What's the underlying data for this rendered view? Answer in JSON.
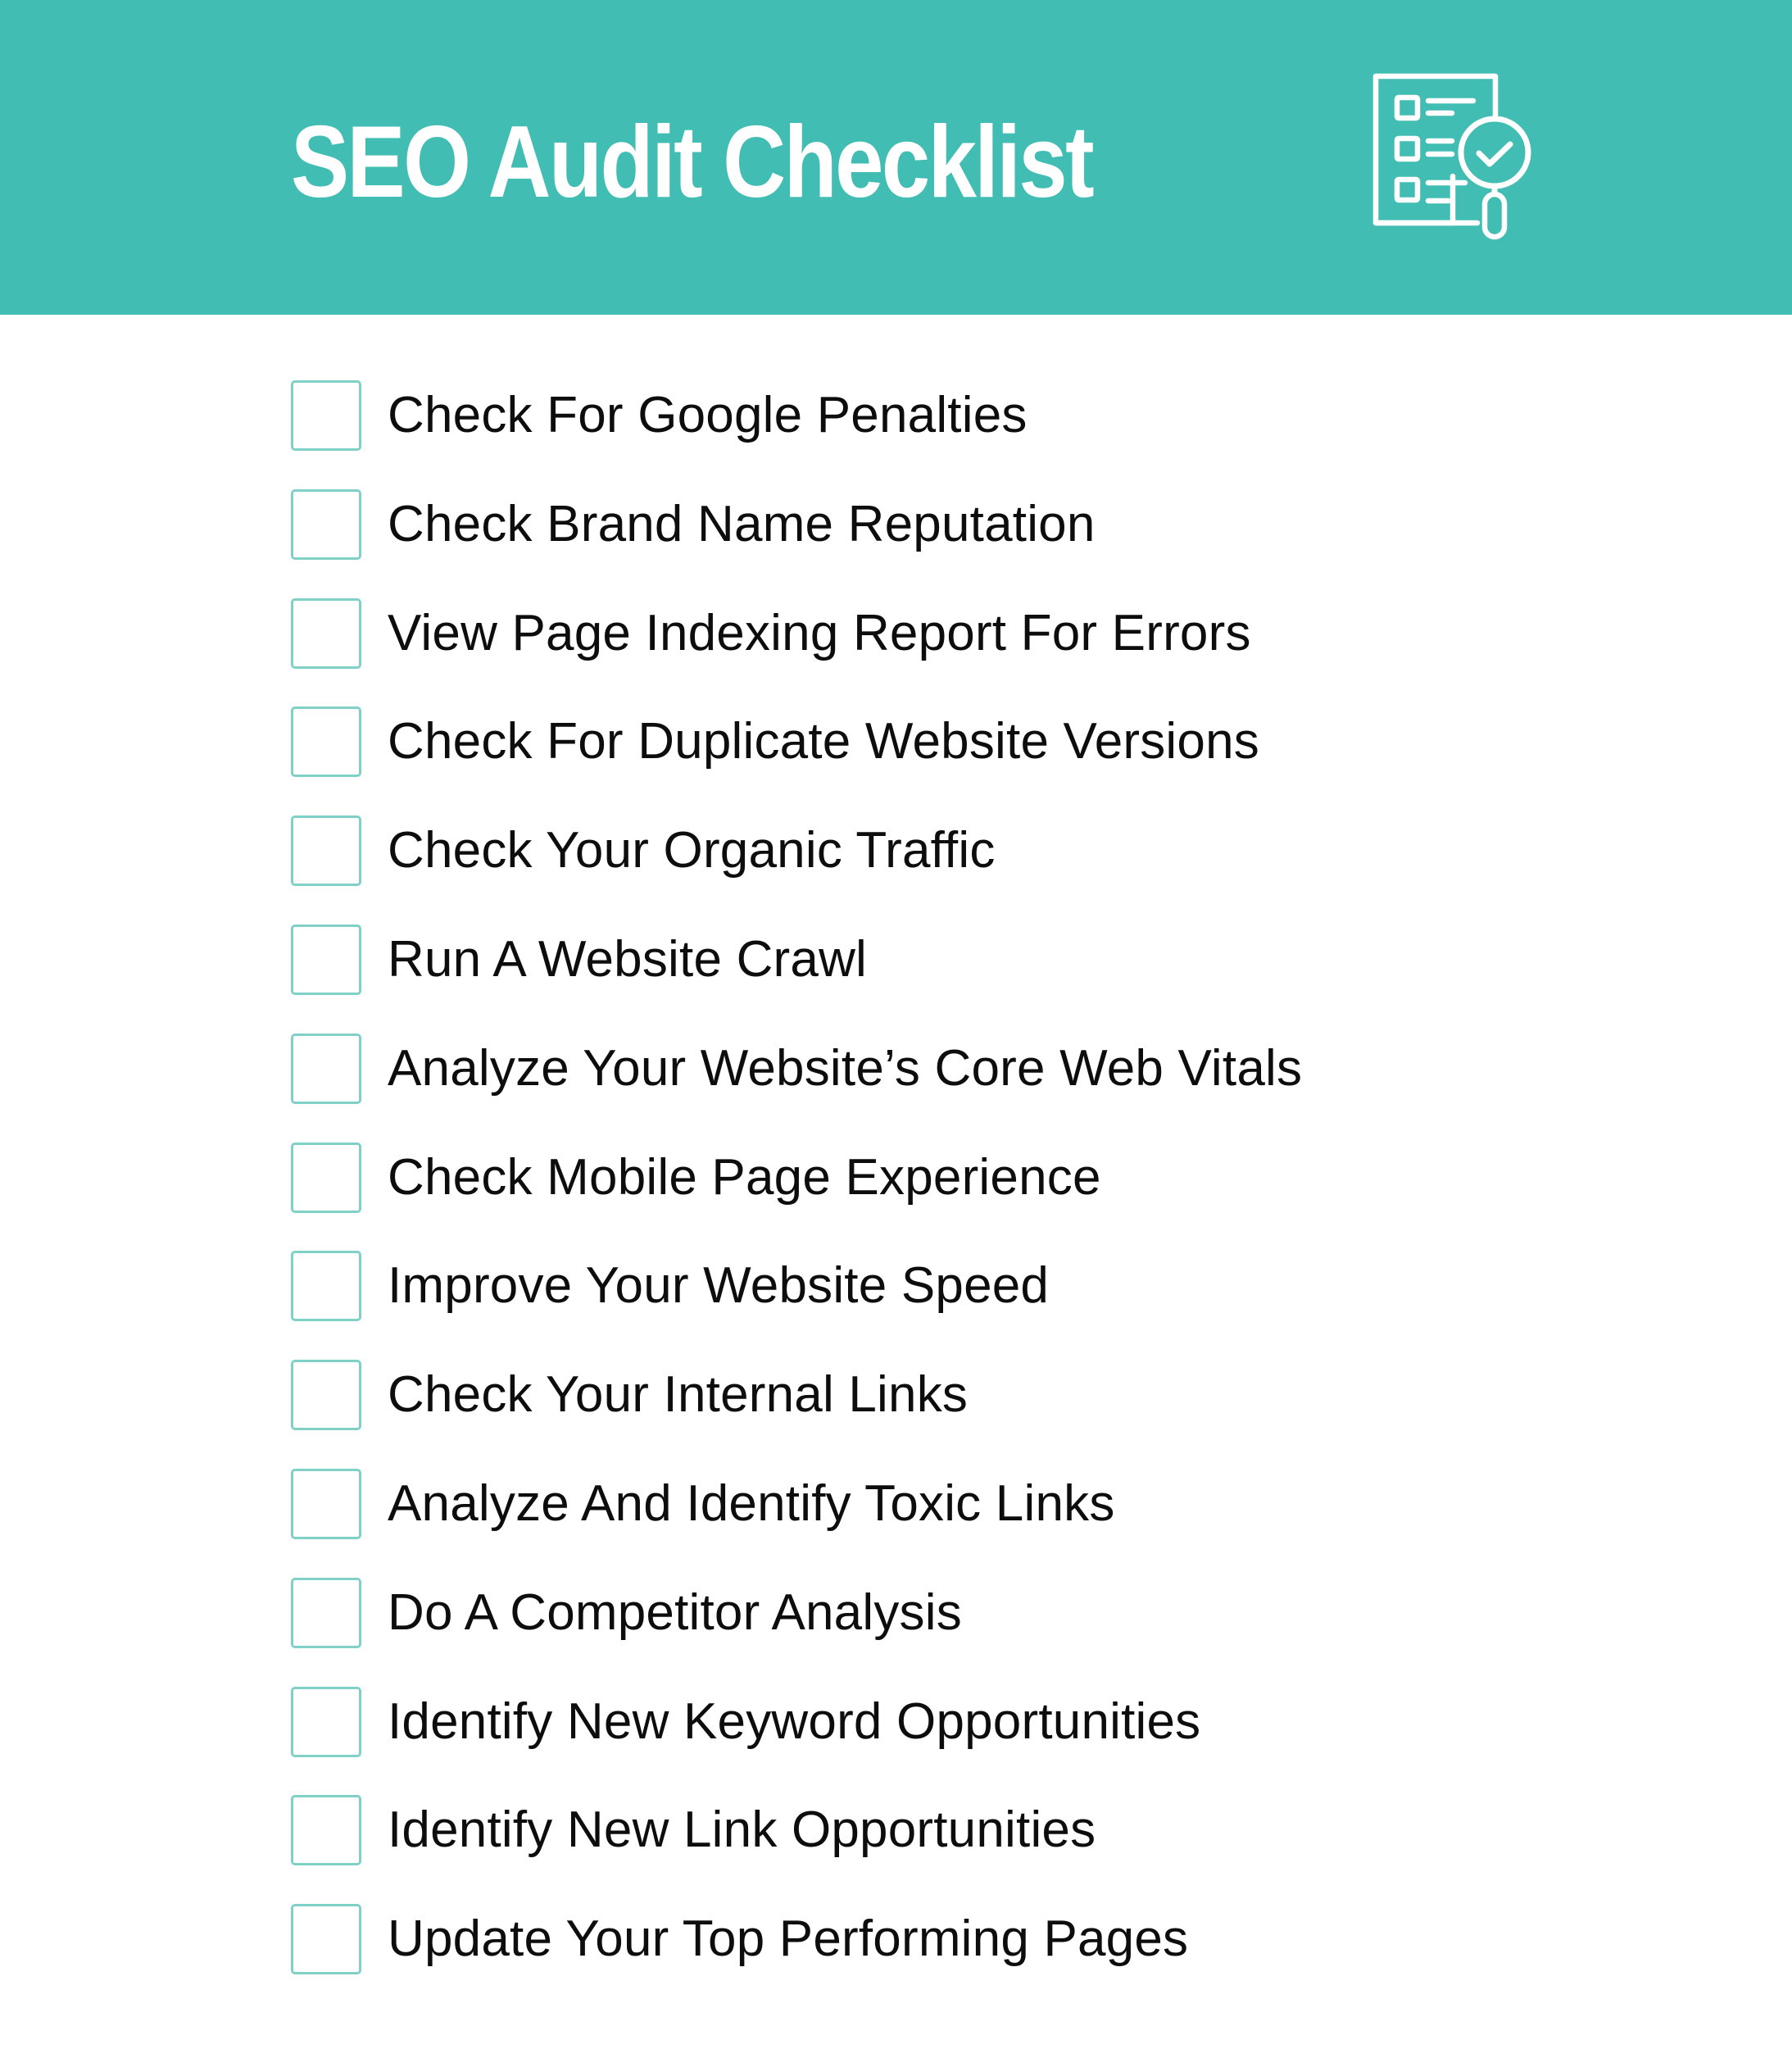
{
  "header": {
    "title": "SEO Audit Checklist",
    "icon": "checklist-magnifier-icon",
    "background_color": "#42bdb3",
    "title_color": "#ffffff"
  },
  "checklist": {
    "checkbox_border_color": "#7fd0c7",
    "items": [
      {
        "label": "Check For Google Penalties",
        "checked": false
      },
      {
        "label": "Check Brand Name Reputation",
        "checked": false
      },
      {
        "label": "View Page Indexing Report For Errors",
        "checked": false
      },
      {
        "label": "Check For Duplicate Website Versions",
        "checked": false
      },
      {
        "label": "Check Your Organic Traffic",
        "checked": false
      },
      {
        "label": "Run A Website Crawl",
        "checked": false
      },
      {
        "label": "Analyze Your Website’s Core Web Vitals",
        "checked": false
      },
      {
        "label": "Check Mobile Page Experience",
        "checked": false
      },
      {
        "label": "Improve Your Website Speed",
        "checked": false
      },
      {
        "label": "Check Your Internal Links",
        "checked": false
      },
      {
        "label": "Analyze And Identify Toxic Links",
        "checked": false
      },
      {
        "label": "Do A Competitor Analysis",
        "checked": false
      },
      {
        "label": "Identify New Keyword Opportunities",
        "checked": false
      },
      {
        "label": "Identify New Link Opportunities",
        "checked": false
      },
      {
        "label": "Update Your Top Performing Pages",
        "checked": false
      }
    ]
  }
}
